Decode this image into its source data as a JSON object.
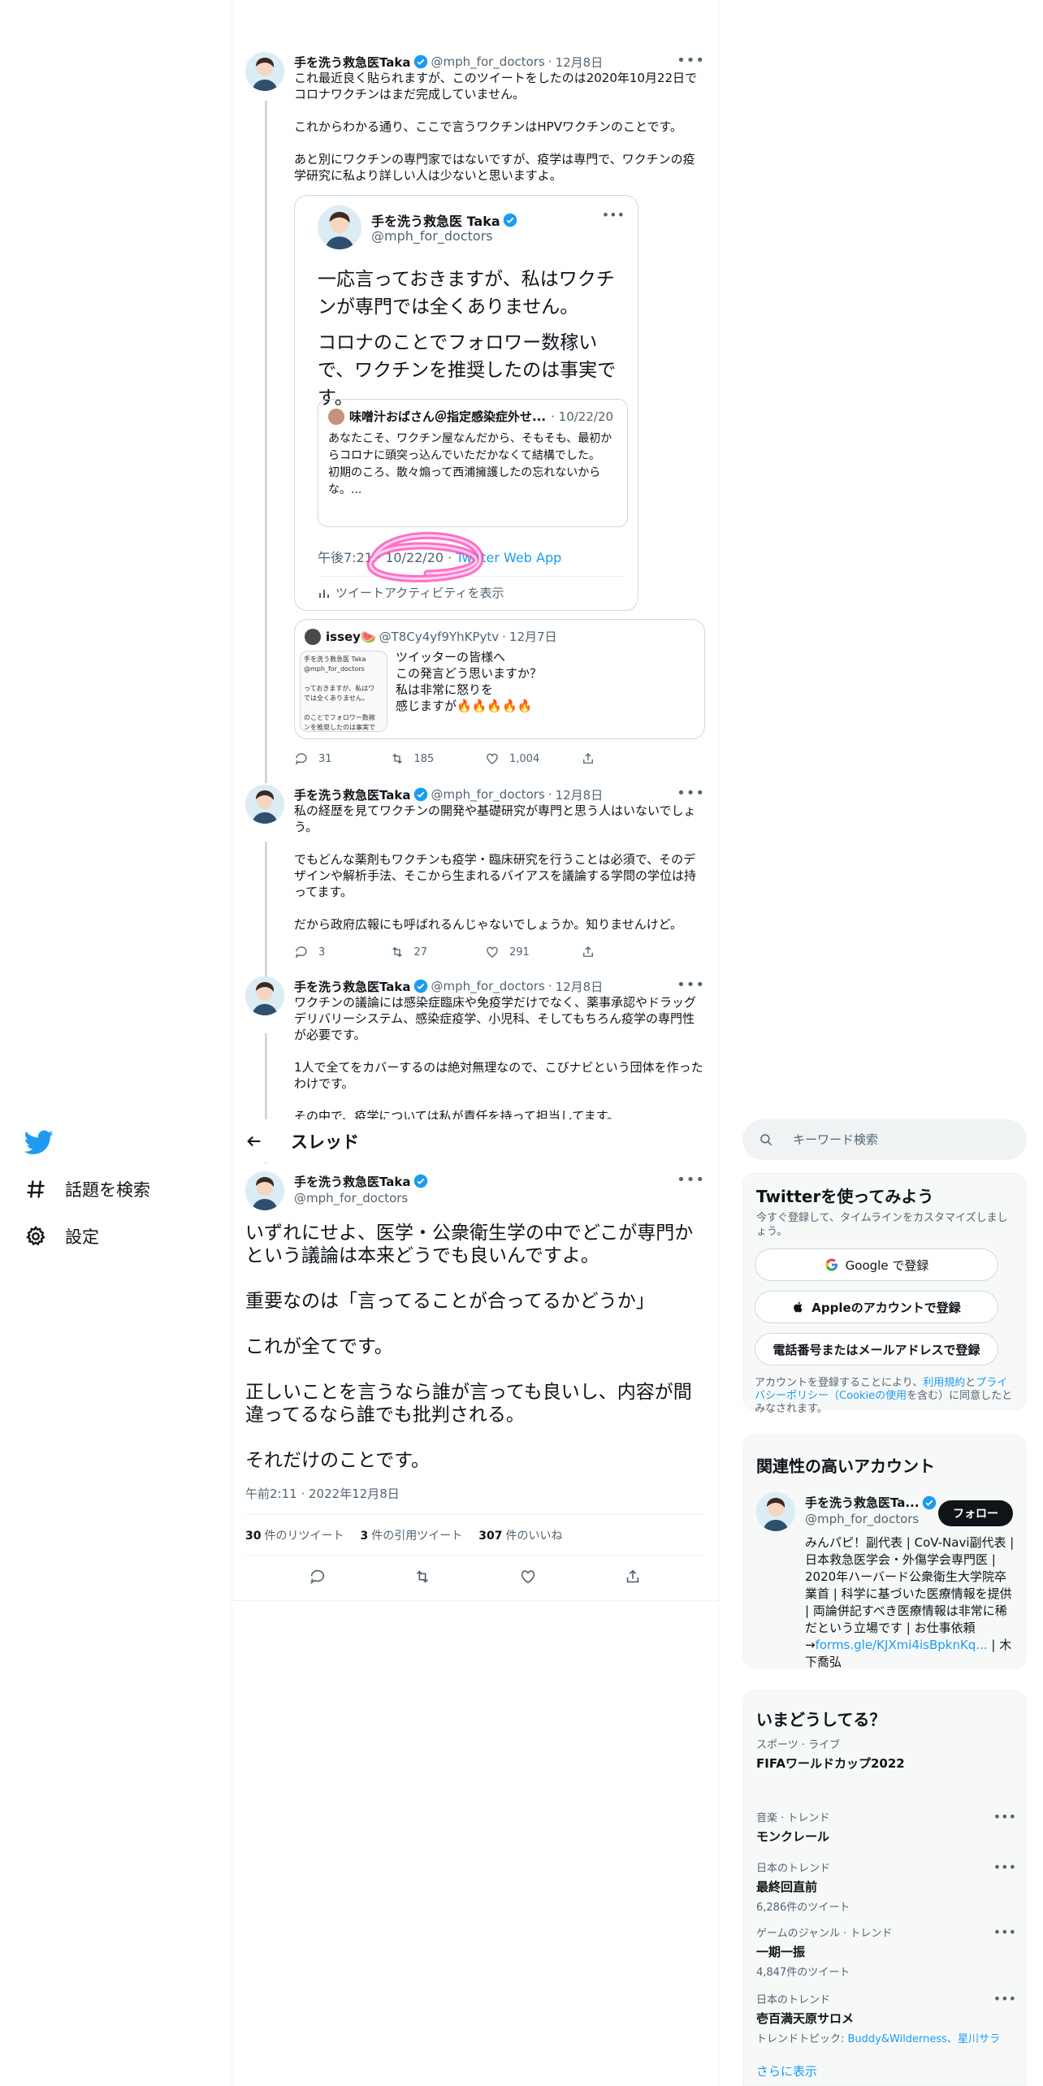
{
  "nav": {
    "items": [
      {
        "label": "話題を検索",
        "icon": "hashtag-icon"
      },
      {
        "label": "設定",
        "icon": "gear-icon"
      }
    ]
  },
  "author": {
    "name": "手を洗う救急医Taka",
    "handle": "@mph_for_doctors"
  },
  "tweet1": {
    "date": "12月8日",
    "text": "これ最近良く貼られますが、このツイートをしたのは2020年10月22日でコロナワクチンはまだ完成していません。\n\nこれからわかる通り、ここで言うワクチンはHPVワクチンのことです。\n\nあと別にワクチンの専門家ではないですが、疫学は専門で、ワクチンの疫学研究に私より詳しい人は少ないと思いますよ。",
    "quote_card": {
      "name": "手を洗う救急医 Taka",
      "handle": "@mph_for_doctors",
      "para1": "一応言っておきますが、私はワクチンが専門では全くありません。",
      "para2": "コロナのことでフォロワー数稼いで、ワクチンを推奨したのは事実です。",
      "inner_name": "味噌汁おばさん＠指定感染症外せ...",
      "inner_date": "10/22/20",
      "inner_text": "あなたこそ、ワクチン屋なんだから、そもそも、最初からコロナに頭突っ込んでいただかなくて結構でした。\n初期のころ、散々煽って西浦擁護したの忘れないからな。...",
      "time": "午後7:21 · 10/22/20 · ",
      "source": "Twitter Web App",
      "activity": "ツイートアクティビティを表示"
    },
    "issey": {
      "name": "issey🍉",
      "handle": "@T8Cy4yf9YhKPytv",
      "date": "12月7日",
      "text": "ツイッターの皆様へ\nこの発言どう思いますか？\n私は非常に怒りを\n感じますが🔥🔥🔥🔥🔥",
      "thumb_text": "手を洗う救急医 Taka\n@mph_for_doctors\n\nっておきますが、私はワ\nでは全くありません。\n\nのことでフォロワー数稼\nンを推奨したのは事実で"
    },
    "replies": "31",
    "retweets": "185",
    "likes": "1,004"
  },
  "tweet2": {
    "date": "12月8日",
    "text": "私の経歴を見てワクチンの開発や基礎研究が専門と思う人はいないでしょう。\n\nでもどんな薬剤もワクチンも疫学・臨床研究を行うことは必須で、そのデザインや解析手法、そこから生まれるバイアスを議論する学問の学位は持ってます。\n\nだから政府広報にも呼ばれるんじゃないでしょうか。知りませんけど。",
    "replies": "3",
    "retweets": "27",
    "likes": "291"
  },
  "tweet3": {
    "date": "12月8日",
    "text": "ワクチンの議論には感染症臨床や免疫学だけでなく、薬事承認やドラッグデリバリーシステム、感染症疫学、小児科、そしてもちろん疫学の専門性が必要です。\n\n1人で全てをカバーするのは絶対無理なので、こびナビという団体を作ったわけです。\n\nその中で、疫学については私が責任を持って担当してます。"
  },
  "header": {
    "title": "スレッド"
  },
  "main_tweet": {
    "text": "いずれにせよ、医学・公衆衛生学の中でどこが専門かという議論は本来どうでも良いんですよ。\n\n重要なのは「言ってることが合ってるかどうか」\n\nこれが全てです。\n\n正しいことを言うなら誰が言っても良いし、内容が間違ってるなら誰でも批判される。\n\nそれだけのことです。",
    "time": "午前2:11 · 2022年12月8日",
    "retweets_count": "30",
    "retweets_label": "件のリツイート",
    "quotes_count": "3",
    "quotes_label": "件の引用ツイート",
    "likes_count": "307",
    "likes_label": "件のいいね"
  },
  "search": {
    "placeholder": "キーワード検索"
  },
  "signup": {
    "title": "Twitterを使ってみよう",
    "subtitle": "今すぐ登録して、タイムラインをカスタマイズしましょう。",
    "google": "Google で登録",
    "apple": "Appleのアカウントで登録",
    "phone": "電話番号またはメールアドレスで登録",
    "note_pre": "アカウントを登録することにより、",
    "note_terms": "利用規約",
    "note_and": "と",
    "note_privacy": "プライバシーポリシー（Cookieの使用",
    "note_post": "を含む）に同意したとみなされます。"
  },
  "related": {
    "title": "関連性の高いアカウント",
    "name": "手を洗う救急医Ta...",
    "handle": "@mph_for_doctors",
    "follow": "フォロー",
    "bio": "みんパピ！副代表 | CoV-Navi副代表 | 日本救急医学会・外傷学会専門医 | 2020年ハーバード公衆衛生大学院卒業首 | 科学に基づいた医療情報を提供 | 両論併記すべき医療情報は非常に稀だという立場です | お仕事依頼→",
    "bio_link": "forms.gle/KJXmi4isBpknKq...",
    "bio_tail": " | 木下喬弘"
  },
  "trends": {
    "title": "いまどうしてる？",
    "items": [
      {
        "category": "スポーツ · ライブ",
        "name": "FIFAワールドカップ2022",
        "count": ""
      },
      {
        "category": "音楽 · トレンド",
        "name": "モンクレール",
        "count": ""
      },
      {
        "category": "日本のトレンド",
        "name": "最終回直前",
        "count": "6,286件のツイート"
      },
      {
        "category": "ゲームのジャンル · トレンド",
        "name": "一期一振",
        "count": "4,847件のツイート"
      },
      {
        "category": "日本のトレンド",
        "name": "壱百満天原サロメ",
        "count": "トレンドトピック: ",
        "links": "Buddy&Wilderness、星川サラ"
      }
    ],
    "show_more": "さらに表示"
  },
  "colors": {
    "accent": "#1d9bf0",
    "text": "#0f1419",
    "muted": "#536471",
    "border": "#cfd9de",
    "scribble": "#ff3fb4"
  }
}
